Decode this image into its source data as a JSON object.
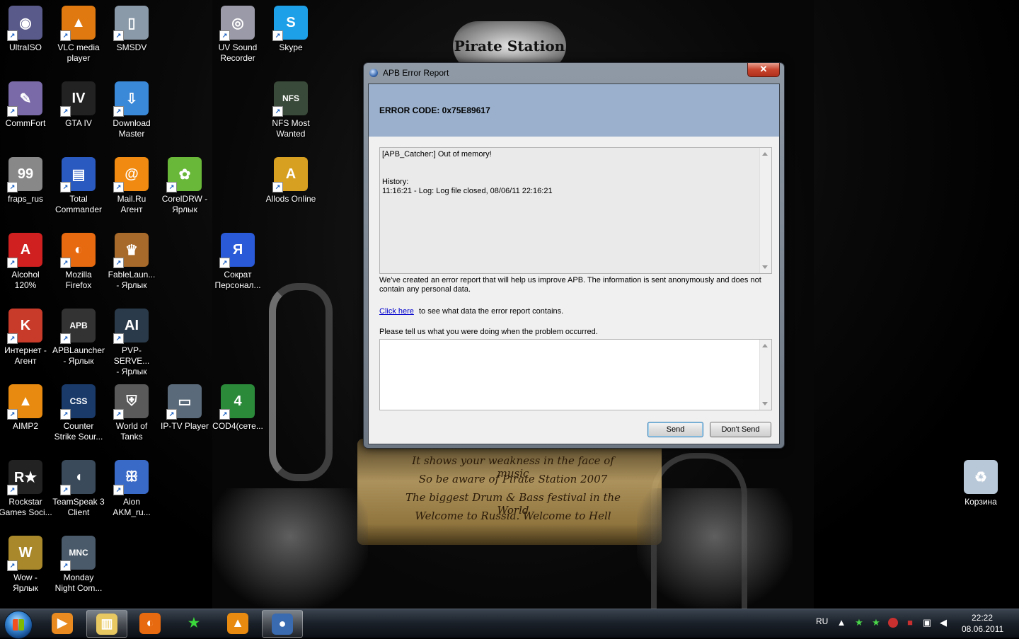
{
  "wallpaper": {
    "badge": "Pirate Station",
    "lines": [
      "It shows your weakness in the face of music",
      "So be aware of Pirate Station 2007",
      "The biggest Drum & Bass festival in the World",
      "Welcome to Russia. Welcome to Hell"
    ]
  },
  "desktop": {
    "icons": [
      {
        "label": "UltraISO",
        "icon": "disc-icon",
        "color": "#5a5a8a"
      },
      {
        "label": "VLC media\nplayer",
        "icon": "vlc-cone-icon",
        "color": "#e07a10"
      },
      {
        "label": "SMSDV",
        "icon": "phone-icon",
        "color": "#8a9aa8"
      },
      {
        "label": "UV Sound\nRecorder",
        "icon": "speaker-icon",
        "color": "#9a9aa8"
      },
      {
        "label": "Skype",
        "icon": "skype-icon",
        "color": "#1ea0e8"
      },
      {
        "label": "CommFort",
        "icon": "commfort-icon",
        "color": "#7a6aa8"
      },
      {
        "label": "GTA IV",
        "icon": "gta-icon",
        "color": "#222222"
      },
      {
        "label": "Download\nMaster",
        "icon": "download-icon",
        "color": "#3a88d8"
      },
      {
        "label": "NFS Most\nWanted",
        "icon": "nfs-icon",
        "color": "#3a4a3a"
      },
      {
        "label": "fraps_rus",
        "icon": "fraps-icon",
        "color": "#888888"
      },
      {
        "label": "Total\nCommander",
        "icon": "floppy-icon",
        "color": "#2a5ac0"
      },
      {
        "label": "Mail.Ru\nАгент",
        "icon": "at-sign-icon",
        "color": "#f08a10"
      },
      {
        "label": "CorelDRW -\nЯрлык",
        "icon": "corel-icon",
        "color": "#6ab83a"
      },
      {
        "label": "Allods Online",
        "icon": "allods-icon",
        "color": "#d8a020"
      },
      {
        "label": "Alcohol\n120%",
        "icon": "alcohol-icon",
        "color": "#d02020"
      },
      {
        "label": "Mozilla\nFirefox",
        "icon": "firefox-icon",
        "color": "#e86a10"
      },
      {
        "label": "FableLaun...\n- Ярлык",
        "icon": "fable-icon",
        "color": "#a86a2a"
      },
      {
        "label": "Сократ\nПерсонал...",
        "icon": "sokrat-icon",
        "color": "#2a5ad8"
      },
      {
        "label": "Интернет -\nАгент",
        "icon": "agent-icon",
        "color": "#c83a2a"
      },
      {
        "label": "APBLauncher\n- Ярлык",
        "icon": "apb-icon",
        "color": "#333333"
      },
      {
        "label": "PVP-SERVE...\n- Ярлык",
        "icon": "aion-icon",
        "color": "#2a3a4a"
      },
      {
        "label": "AIMP2",
        "icon": "aimp-icon",
        "color": "#e88a10"
      },
      {
        "label": "Counter\nStrike Sour...",
        "icon": "css-icon",
        "color": "#1a3a6a"
      },
      {
        "label": "World of\nTanks",
        "icon": "tanks-icon",
        "color": "#5a5a5a"
      },
      {
        "label": "IP-TV Player",
        "icon": "tv-icon",
        "color": "#5a6a7a"
      },
      {
        "label": "COD4(сете...",
        "icon": "cod4-icon",
        "color": "#2a8a3a"
      },
      {
        "label": "Rockstar\nGames Soci...",
        "icon": "rockstar-icon",
        "color": "#222222"
      },
      {
        "label": "TeamSpeak 3\nClient",
        "icon": "teamspeak-icon",
        "color": "#3a4a5a"
      },
      {
        "label": "Aion\nAKM_ru...",
        "icon": "butterfly-icon",
        "color": "#3a6ac8"
      },
      {
        "label": "Wow -\nЯрлык",
        "icon": "wow-icon",
        "color": "#a8882a"
      },
      {
        "label": "Monday\nNight Com...",
        "icon": "mnc-icon",
        "color": "#4a5a6a"
      },
      {
        "label": "Корзина",
        "icon": "recycle-bin-icon",
        "color": "#b8c8d8"
      }
    ]
  },
  "dialog": {
    "title": "APB Error Report",
    "close_label": "✕",
    "error_code": "ERROR CODE: 0x75E89617",
    "log": {
      "line1": "[APB_Catcher:] Out of memory!",
      "line2": "History:",
      "line3": "11:16:21 - Log: Log file closed, 08/06/11 22:16:21"
    },
    "info_text_1": "We've created an error report that will help us improve APB. The information is sent anonymously and does not",
    "info_text_2": "contain any personal data.",
    "link_text": "Click here",
    "link_suffix": "to see what data the error report contains.",
    "prompt": "Please tell us what you were doing when the problem occurred.",
    "comment_value": "",
    "send_label": "Send",
    "dont_send_label": "Don't Send"
  },
  "taskbar": {
    "buttons": [
      {
        "icon": "media-player-icon",
        "active": false
      },
      {
        "icon": "explorer-folder-icon",
        "active": true
      },
      {
        "icon": "firefox-icon",
        "active": false
      },
      {
        "icon": "star-icon",
        "active": false
      },
      {
        "icon": "aimp-icon",
        "active": false
      },
      {
        "icon": "apb-error-icon",
        "active": true
      }
    ],
    "language": "RU",
    "time": "22:22",
    "date": "08.06.2011"
  }
}
